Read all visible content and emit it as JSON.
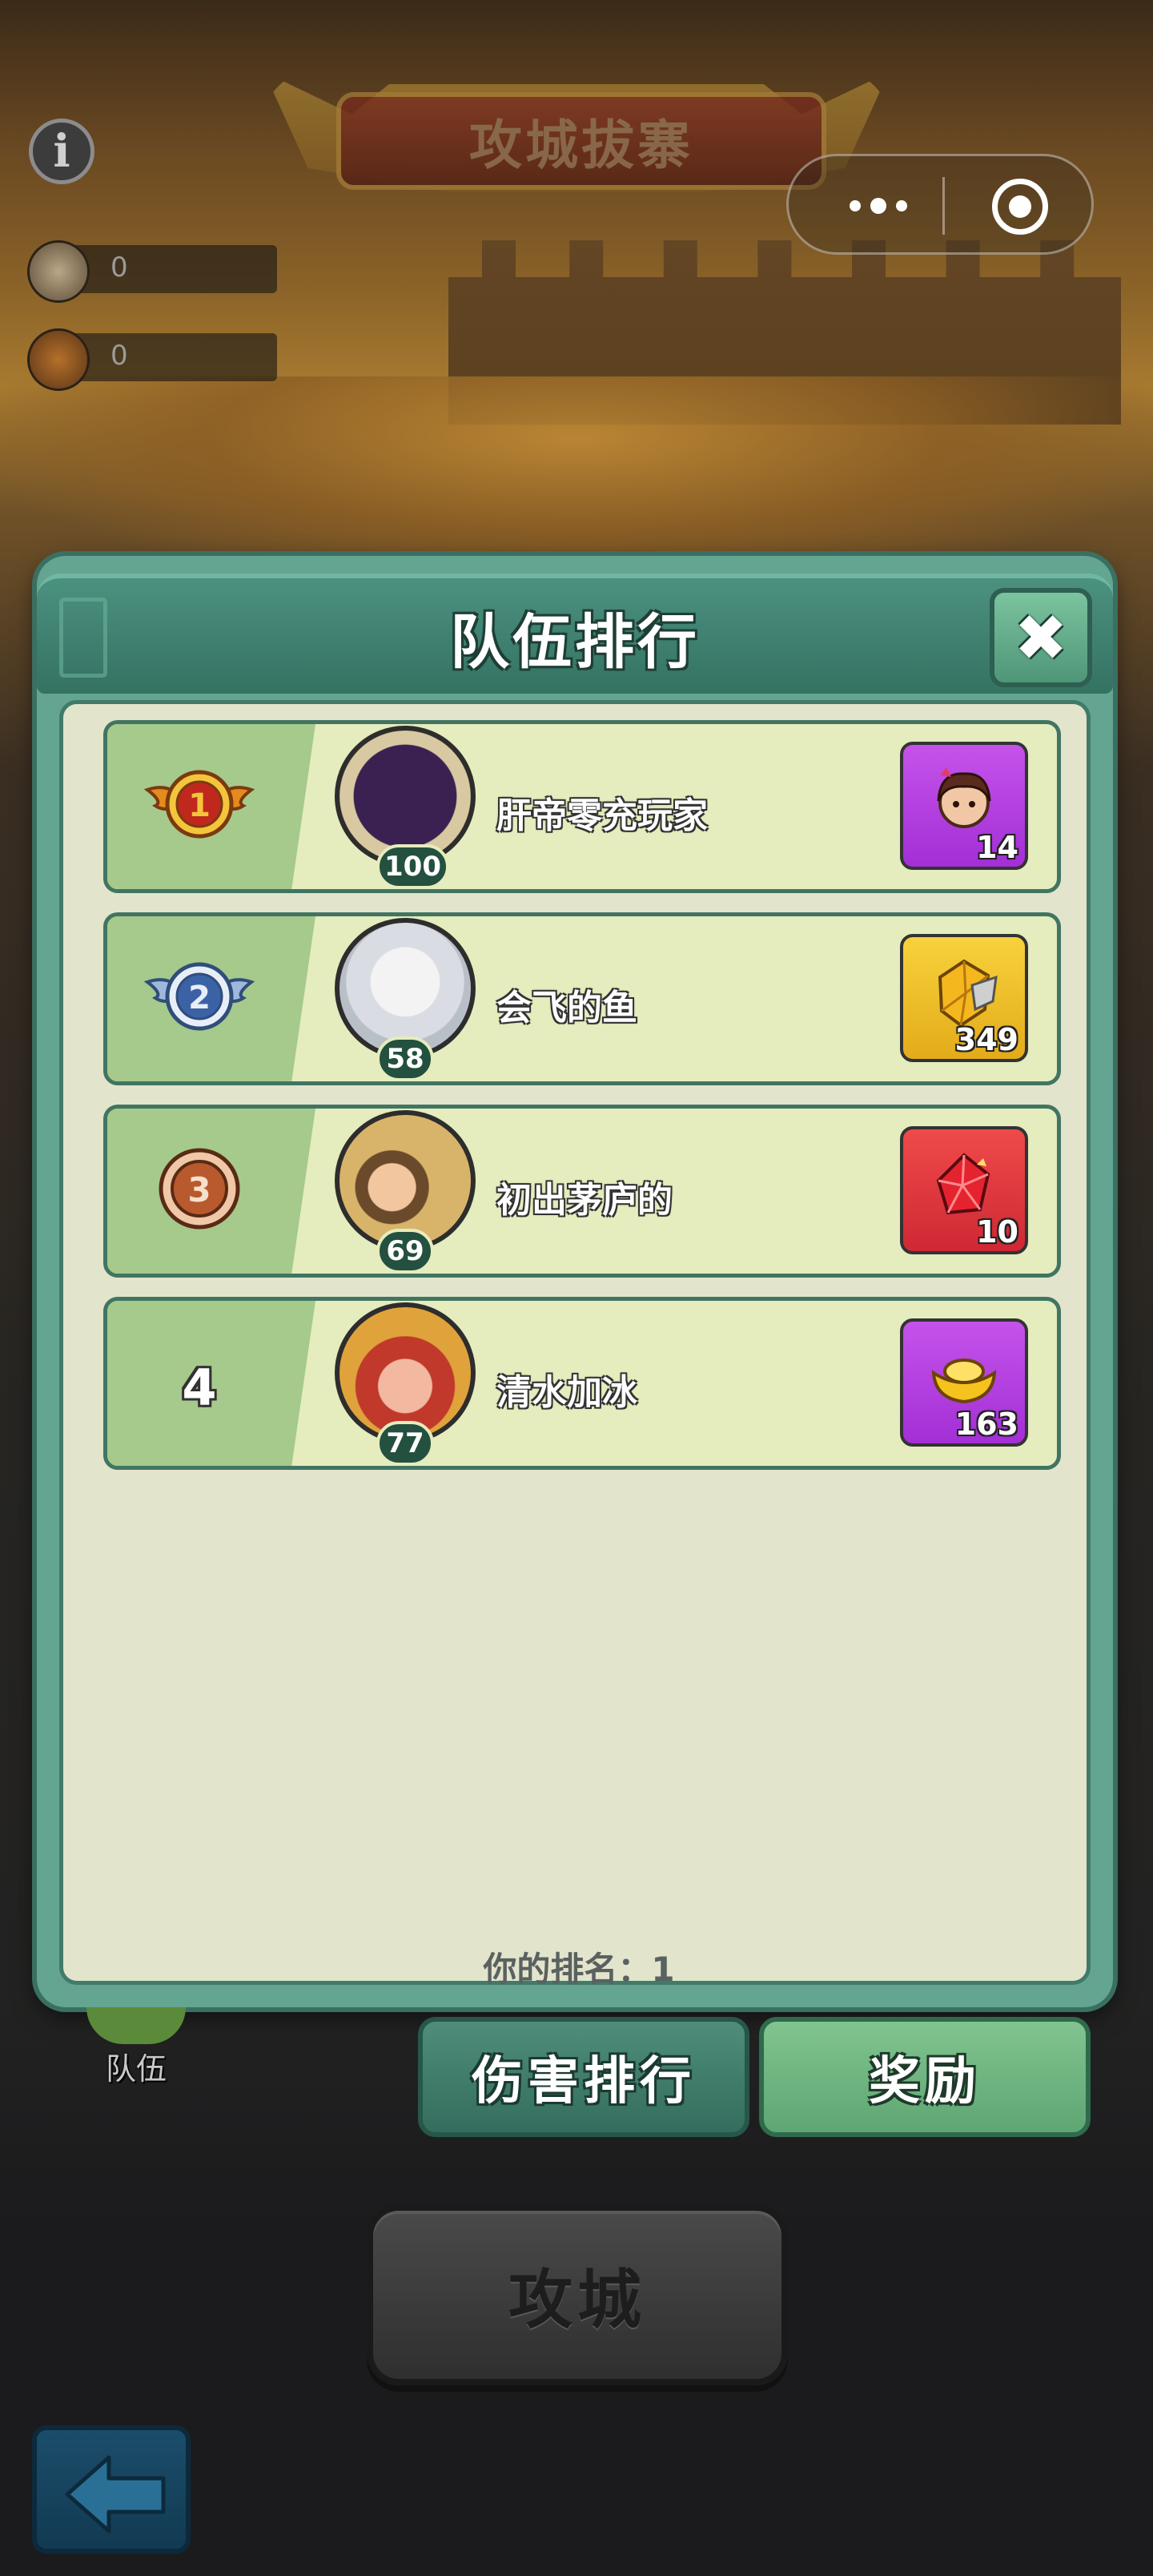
{
  "hud": {
    "banner_title": "攻城拔寨",
    "info_label": "i",
    "resources": [
      {
        "icon": "stone-block-icon",
        "value": "0"
      },
      {
        "icon": "scroll-map-icon",
        "value": "0"
      }
    ],
    "capsule_icons": [
      "more-dots-icon",
      "close-target-icon"
    ]
  },
  "modal": {
    "title": "队伍排行",
    "close_label": "✖",
    "rows": [
      {
        "rank": "1",
        "medal": "gold-wing-medal",
        "name": "肝帝零充玩家",
        "level": "100",
        "reward_icon": "character-portrait-reward",
        "reward_count": "14",
        "reward_color": "#b43fe0"
      },
      {
        "rank": "2",
        "medal": "silver-wing-medal",
        "name": "会飞的鱼",
        "level": "58",
        "reward_icon": "gold-ore-reward",
        "reward_count": "349",
        "reward_color": "#f0c22a"
      },
      {
        "rank": "3",
        "medal": "bronze-medal",
        "name": "初出茅庐的",
        "level": "69",
        "reward_icon": "red-gem-reward",
        "reward_count": "10",
        "reward_color": "#e0343c"
      },
      {
        "rank": "4",
        "medal": "",
        "name": "清水加冰",
        "level": "77",
        "reward_icon": "gold-ingot-reward",
        "reward_count": "163",
        "reward_color": "#b43fe0"
      }
    ],
    "my_rank": "你的排名：1"
  },
  "bottom": {
    "team_label": "队伍",
    "tab_damage": "伤害排行",
    "tab_reward": "奖励",
    "attack_label": "攻城"
  },
  "colors": {
    "panel_green": "#63a590",
    "row_bg": "#e5ecbd",
    "rank_strip": "#a6c98c"
  }
}
